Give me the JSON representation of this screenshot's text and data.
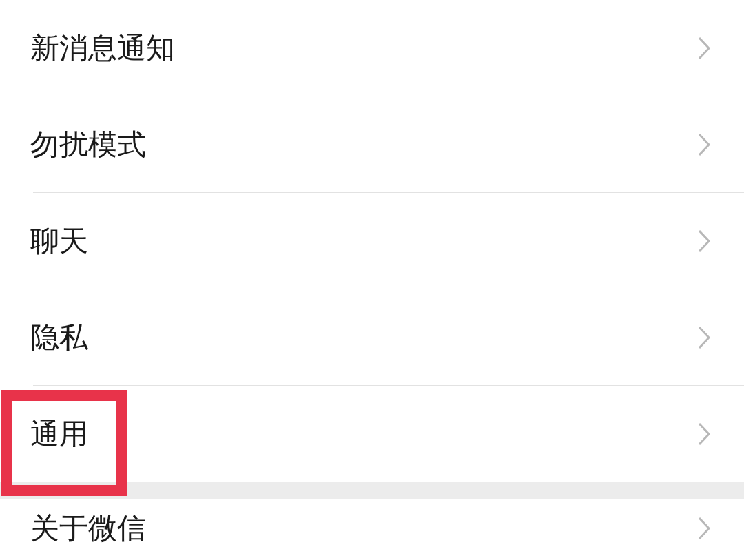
{
  "sections": [
    {
      "items": [
        {
          "label": "新消息通知",
          "highlighted": false
        },
        {
          "label": "勿扰模式",
          "highlighted": false
        },
        {
          "label": "聊天",
          "highlighted": false
        },
        {
          "label": "隐私",
          "highlighted": false
        },
        {
          "label": "通用",
          "highlighted": true
        }
      ]
    },
    {
      "items": [
        {
          "label": "关于微信",
          "highlighted": false
        }
      ]
    }
  ]
}
